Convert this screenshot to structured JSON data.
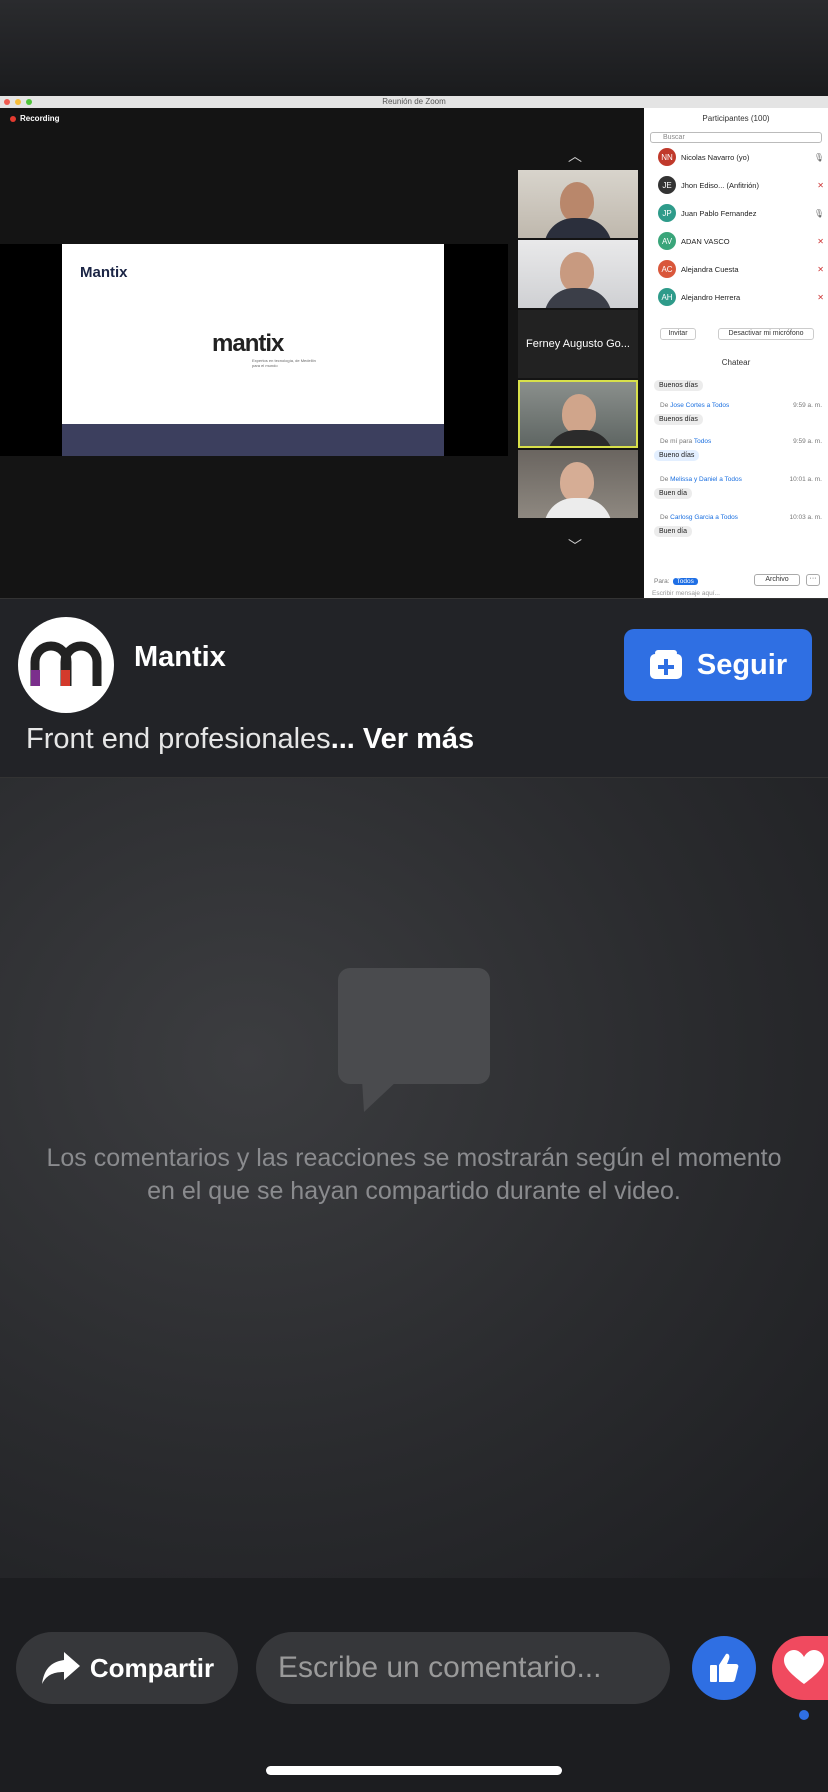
{
  "zoom": {
    "window_title": "Reunión de Zoom",
    "recording_label": "Recording",
    "slide_title": "Mantix",
    "slide_logo": "mantix",
    "slide_tagline": "Expertos en tecnología, de Medellín para el mundo",
    "tile_name": "Ferney Augusto Go...",
    "participants_title": "Participantes (100)",
    "search_placeholder": "Buscar",
    "participants": [
      {
        "initials": "NN",
        "name": "Nicolas Navarro (yo)",
        "color": "#c0392b"
      },
      {
        "initials": "JE",
        "name": "Jhon Ediso... (Anfitrión)",
        "color": "#333333"
      },
      {
        "initials": "JP",
        "name": "Juan Pablo Fernandez",
        "color": "#2e9b8a"
      },
      {
        "initials": "AV",
        "name": "ADAN VASCO",
        "color": "#3aa57a"
      },
      {
        "initials": "AC",
        "name": "Alejandra Cuesta",
        "color": "#d9573b"
      },
      {
        "initials": "AH",
        "name": "Alejandro Herrera",
        "color": "#2e9b8a"
      }
    ],
    "invite_label": "Invitar",
    "mute_label": "Desactivar mi micrófono",
    "chat_title": "Chatear",
    "chat": [
      {
        "message": "Buenos días"
      },
      {
        "from": "De",
        "who": "Jose Cortes a Todos",
        "time": "9:59 a. m.",
        "message": "Buenos días"
      },
      {
        "from": "De mí para",
        "who": "Todos",
        "time": "9:59 a. m.",
        "message": "Bueno días"
      },
      {
        "from": "De",
        "who": "Melissa y Daniel a Todos",
        "time": "10:01 a. m.",
        "message": "Buen día"
      },
      {
        "from": "De",
        "who": "Carlosg Garcia a Todos",
        "time": "10:03 a. m.",
        "message": "Buen día"
      }
    ],
    "to_label": "Para:",
    "to_value": "Todos",
    "file_label": "Archivo",
    "more_label": "···",
    "chat_placeholder": "Escribir mensaje aquí..."
  },
  "page": {
    "name": "Mantix",
    "follow_label": "Seguir",
    "description": "Front end profesionales",
    "see_more": "... Ver más"
  },
  "comments": {
    "empty_message": "Los comentarios y las reacciones se mostrarán según el momento en el que se hayan compartido durante el video."
  },
  "bottom_bar": {
    "share_label": "Compartir",
    "comment_placeholder": "Escribe un comentario..."
  },
  "colors": {
    "accent": "#2f6fe3",
    "love": "#f04a5f",
    "background": "#1c1d20"
  }
}
